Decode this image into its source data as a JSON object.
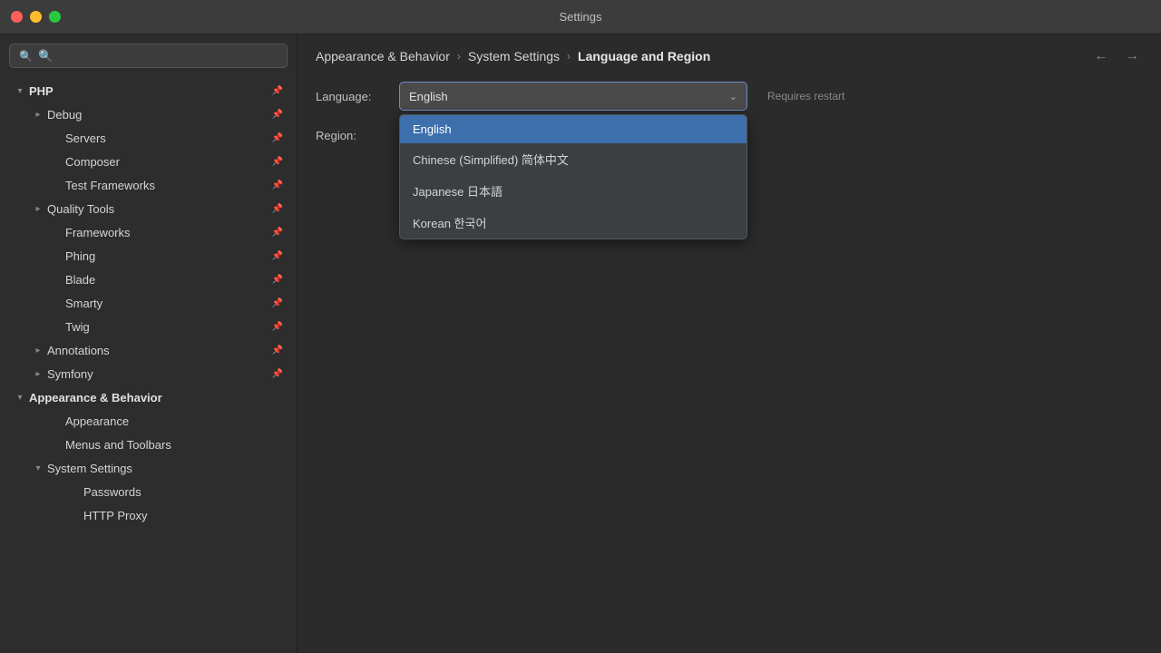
{
  "window": {
    "title": "Settings"
  },
  "titlebar": {
    "close_label": "",
    "minimize_label": "",
    "maximize_label": ""
  },
  "search": {
    "placeholder": "🔍"
  },
  "sidebar": {
    "sections": [
      {
        "id": "php",
        "label": "PHP",
        "level": "root",
        "expanded": true,
        "children": [
          {
            "id": "debug",
            "label": "Debug",
            "level": "1",
            "expanded": false
          },
          {
            "id": "servers",
            "label": "Servers",
            "level": "2"
          },
          {
            "id": "composer",
            "label": "Composer",
            "level": "2"
          },
          {
            "id": "test-frameworks",
            "label": "Test Frameworks",
            "level": "2"
          },
          {
            "id": "quality-tools",
            "label": "Quality Tools",
            "level": "1",
            "expanded": false
          },
          {
            "id": "frameworks",
            "label": "Frameworks",
            "level": "2"
          },
          {
            "id": "phing",
            "label": "Phing",
            "level": "2"
          },
          {
            "id": "blade",
            "label": "Blade",
            "level": "2"
          },
          {
            "id": "smarty",
            "label": "Smarty",
            "level": "2"
          },
          {
            "id": "twig",
            "label": "Twig",
            "level": "2"
          },
          {
            "id": "annotations",
            "label": "Annotations",
            "level": "1",
            "expanded": false
          },
          {
            "id": "symfony",
            "label": "Symfony",
            "level": "1",
            "expanded": false
          }
        ]
      },
      {
        "id": "appearance-behavior",
        "label": "Appearance & Behavior",
        "level": "root",
        "expanded": true,
        "children": [
          {
            "id": "appearance",
            "label": "Appearance",
            "level": "2"
          },
          {
            "id": "menus-toolbars",
            "label": "Menus and Toolbars",
            "level": "2"
          },
          {
            "id": "system-settings",
            "label": "System Settings",
            "level": "1",
            "expanded": true
          },
          {
            "id": "passwords",
            "label": "Passwords",
            "level": "3"
          },
          {
            "id": "http-proxy",
            "label": "HTTP Proxy",
            "level": "3"
          }
        ]
      }
    ]
  },
  "breadcrumb": {
    "items": [
      {
        "label": "Appearance & Behavior",
        "active": false
      },
      {
        "label": "System Settings",
        "active": false
      },
      {
        "label": "Language and Region",
        "active": true
      }
    ]
  },
  "content": {
    "language_label": "Language:",
    "region_label": "Region:",
    "requires_restart": "Requires restart",
    "selected_language": "English",
    "dropdown": {
      "options": [
        {
          "label": "English",
          "selected": true
        },
        {
          "label": "Chinese (Simplified) 简体中文",
          "selected": false
        },
        {
          "label": "Japanese 日本語",
          "selected": false
        },
        {
          "label": "Korean 한국어",
          "selected": false
        }
      ]
    }
  },
  "icons": {
    "search": "🔍",
    "pin": "📌",
    "chevron_right": "›",
    "chevron_down": "▾",
    "chevron_right_small": "▸",
    "arrow_left": "←",
    "arrow_right": "→",
    "dropdown_chevron": "⌄"
  }
}
